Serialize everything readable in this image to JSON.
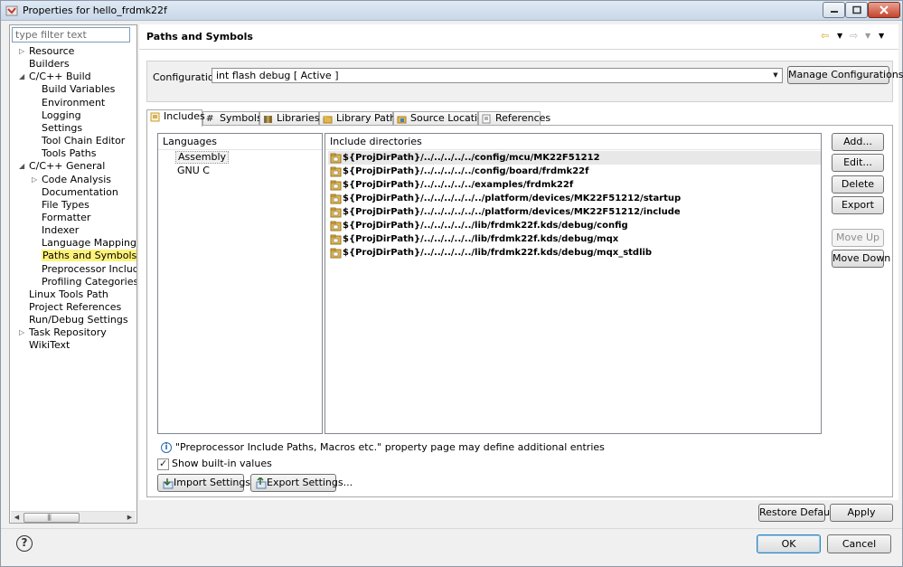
{
  "window": {
    "title": "Properties for hello_frdmk22f"
  },
  "sidebar": {
    "filter_placeholder": "type filter text",
    "items": [
      {
        "label": "Resource",
        "level": 1,
        "expandable": true
      },
      {
        "label": "Builders",
        "level": 1,
        "expandable": false
      },
      {
        "label": "C/C++ Build",
        "level": 1,
        "expandable": true,
        "expanded": true
      },
      {
        "label": "Build Variables",
        "level": 2,
        "expandable": false
      },
      {
        "label": "Environment",
        "level": 2,
        "expandable": false
      },
      {
        "label": "Logging",
        "level": 2,
        "expandable": false
      },
      {
        "label": "Settings",
        "level": 2,
        "expandable": false
      },
      {
        "label": "Tool Chain Editor",
        "level": 2,
        "expandable": false
      },
      {
        "label": "Tools Paths",
        "level": 2,
        "expandable": false
      },
      {
        "label": "C/C++ General",
        "level": 1,
        "expandable": true,
        "expanded": true
      },
      {
        "label": "Code Analysis",
        "level": 2,
        "expandable": true
      },
      {
        "label": "Documentation",
        "level": 2,
        "expandable": false
      },
      {
        "label": "File Types",
        "level": 2,
        "expandable": false
      },
      {
        "label": "Formatter",
        "level": 2,
        "expandable": false
      },
      {
        "label": "Indexer",
        "level": 2,
        "expandable": false
      },
      {
        "label": "Language Mappings",
        "level": 2,
        "expandable": false
      },
      {
        "label": "Paths and Symbols",
        "level": 2,
        "expandable": false,
        "selected": true
      },
      {
        "label": "Preprocessor Include Pa",
        "level": 2,
        "expandable": false
      },
      {
        "label": "Profiling Categories",
        "level": 2,
        "expandable": false
      },
      {
        "label": "Linux Tools Path",
        "level": 1,
        "expandable": false
      },
      {
        "label": "Project References",
        "level": 1,
        "expandable": false
      },
      {
        "label": "Run/Debug Settings",
        "level": 1,
        "expandable": false
      },
      {
        "label": "Task Repository",
        "level": 1,
        "expandable": true
      },
      {
        "label": "WikiText",
        "level": 1,
        "expandable": false
      }
    ]
  },
  "page": {
    "title": "Paths and Symbols",
    "configuration_label": "Configuration:",
    "configuration_value": "int flash debug  [ Active ]",
    "manage_button": "Manage Configurations..."
  },
  "tabs": [
    {
      "label": "Includes",
      "icon": "includes-icon",
      "active": true
    },
    {
      "label": "Symbols",
      "icon": "hash-icon"
    },
    {
      "label": "Libraries",
      "icon": "library-icon"
    },
    {
      "label": "Library Paths",
      "icon": "library-path-icon"
    },
    {
      "label": "Source Location",
      "icon": "source-folder-icon"
    },
    {
      "label": "References",
      "icon": "references-icon"
    }
  ],
  "languages": {
    "header": "Languages",
    "items": [
      "Assembly",
      "GNU C"
    ],
    "selected": "Assembly"
  },
  "includes": {
    "header": "Include directories",
    "items": [
      "${ProjDirPath}/../../../../../config/mcu/MK22F51212",
      "${ProjDirPath}/../../../../../config/board/frdmk22f",
      "${ProjDirPath}/../../../../../examples/frdmk22f",
      "${ProjDirPath}/../../../../../../platform/devices/MK22F51212/startup",
      "${ProjDirPath}/../../../../../../platform/devices/MK22F51212/include",
      "${ProjDirPath}/../../../../../lib/frdmk22f.kds/debug/config",
      "${ProjDirPath}/../../../../../lib/frdmk22f.kds/debug/mqx",
      "${ProjDirPath}/../../../../../lib/frdmk22f.kds/debug/mqx_stdlib"
    ]
  },
  "side_buttons": {
    "add": "Add...",
    "edit": "Edit...",
    "delete": "Delete",
    "export": "Export",
    "move_up": "Move Up",
    "move_down": "Move Down"
  },
  "info_text": "\"Preprocessor Include Paths, Macros etc.\" property page may define additional entries",
  "show_builtin_label": "Show built-in values",
  "import_settings": "Import Settings...",
  "export_settings": "Export Settings...",
  "restore_defaults": "Restore Defaults",
  "apply": "Apply",
  "ok": "OK",
  "cancel": "Cancel",
  "colors": {
    "selection_highlight": "#fff27a",
    "folder_icon": "#e2b84a"
  }
}
